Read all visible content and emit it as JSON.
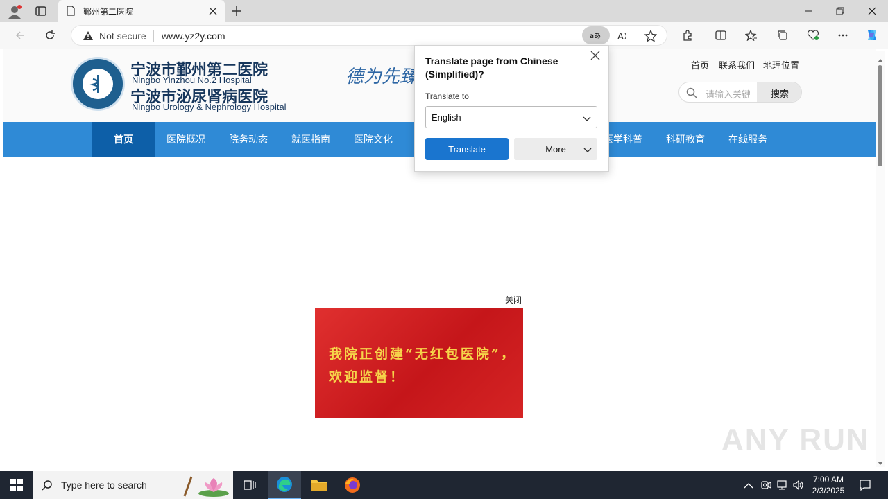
{
  "browser": {
    "tab_title": "鄞州第二医院",
    "not_secure_label": "Not secure",
    "url": "www.yz2y.com"
  },
  "header": {
    "name_cn_1": "宁波市鄞州第二医院",
    "name_en_1": "Ningbo Yinzhou No.2 Hospital",
    "name_cn_2": "宁波市泌尿肾病医院",
    "name_en_2": "Ningbo Urology & Nephrology Hospital",
    "calligraphy": "德为先臻",
    "links": [
      "首页",
      "联系我们",
      "地理位置"
    ],
    "search_placeholder": "请输入关键字",
    "search_button": "搜索"
  },
  "nav": {
    "items": [
      "首页",
      "医院概况",
      "院务动态",
      "就医指南",
      "医院文化",
      "",
      "",
      "医学科普",
      "科研教育",
      "在线服务"
    ]
  },
  "popup": {
    "close_label": "关闭",
    "banner_text": "我院正创建“无红包医院”，欢迎监督！"
  },
  "translate_dialog": {
    "title": "Translate page from Chinese (Simplified)?",
    "translate_to_label": "Translate to",
    "selected_language": "English",
    "translate_button": "Translate",
    "more_button": "More"
  },
  "watermark": "ANY RUN",
  "taskbar": {
    "search_placeholder": "Type here to search",
    "time": "7:00 AM",
    "date": "2/3/2025"
  }
}
